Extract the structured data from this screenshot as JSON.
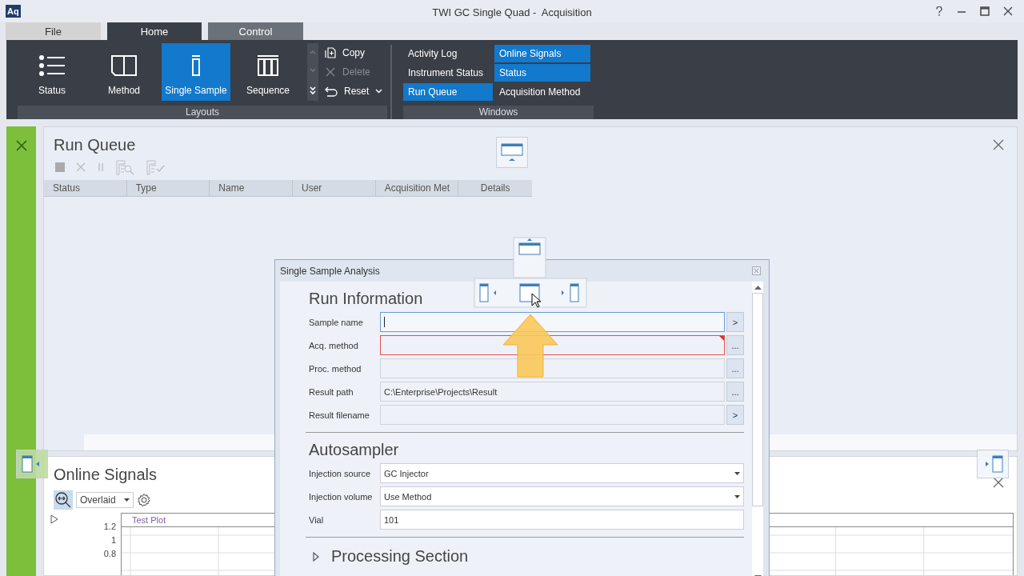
{
  "window": {
    "logo": "Aq",
    "title": "TWI GC Single Quad -  Acquisition"
  },
  "ribbon_tabs": [
    {
      "label": "File",
      "kind": "file",
      "selected": false
    },
    {
      "label": "Home",
      "kind": "tab",
      "selected": true
    },
    {
      "label": "Control",
      "kind": "tab",
      "selected": false
    }
  ],
  "layouts": {
    "label": "Layouts",
    "items": [
      {
        "label": "Status",
        "kind": "list",
        "selected": false
      },
      {
        "label": "Method",
        "kind": "book",
        "selected": false
      },
      {
        "label": "Single Sample",
        "kind": "vial",
        "selected": true
      },
      {
        "label": "Sequence",
        "kind": "vials",
        "selected": false
      }
    ],
    "actions": [
      {
        "label": "Copy",
        "kind": "copy",
        "disabled": false
      },
      {
        "label": "Delete",
        "kind": "delete",
        "disabled": true
      },
      {
        "label": "Reset",
        "kind": "reset",
        "disabled": false
      }
    ]
  },
  "windows": {
    "label": "Windows",
    "items": [
      {
        "label": "Activity Log",
        "selected": false
      },
      {
        "label": "Online Signals",
        "selected": true
      },
      {
        "label": "Instrument Status",
        "selected": false
      },
      {
        "label": "Status",
        "selected": true
      },
      {
        "label": "Run Queue",
        "selected": true
      },
      {
        "label": "Acquisition Method",
        "selected": false
      }
    ]
  },
  "run_queue": {
    "title": "Run Queue",
    "columns": [
      "Status",
      "Type",
      "Name",
      "User",
      "Acquisition Met",
      "Details"
    ]
  },
  "online_signals": {
    "title": "Online Signals",
    "view_mode": "Overlaid",
    "plot_title": "Test Plot",
    "y_ticks": [
      "1.2",
      "1",
      "0.8"
    ]
  },
  "dialog": {
    "title": "Single Sample Analysis",
    "run_information": {
      "title": "Run Information",
      "fields": [
        {
          "label": "Sample name",
          "button": ">",
          "focused": true,
          "invalid": false
        },
        {
          "label": "Acq. method",
          "button": "...",
          "focused": false,
          "invalid": true
        },
        {
          "label": "Proc. method",
          "button": "...",
          "focused": false,
          "invalid": false
        },
        {
          "label": "Result path",
          "value": "C:\\Enterprise\\Projects\\Result",
          "button": "...",
          "focused": false,
          "invalid": false
        },
        {
          "label": "Result filename",
          "button": ">",
          "focused": false,
          "invalid": false
        }
      ]
    },
    "autosampler": {
      "title": "Autosampler",
      "fields": [
        {
          "label": "Injection source",
          "value": "GC Injector",
          "kind": "dropdown"
        },
        {
          "label": "Injection volume",
          "value": "Use Method",
          "kind": "dropdown"
        },
        {
          "label": "Vial",
          "value": "101",
          "kind": "text"
        }
      ]
    },
    "processing_section": {
      "title": "Processing Section",
      "expanded": false
    }
  }
}
